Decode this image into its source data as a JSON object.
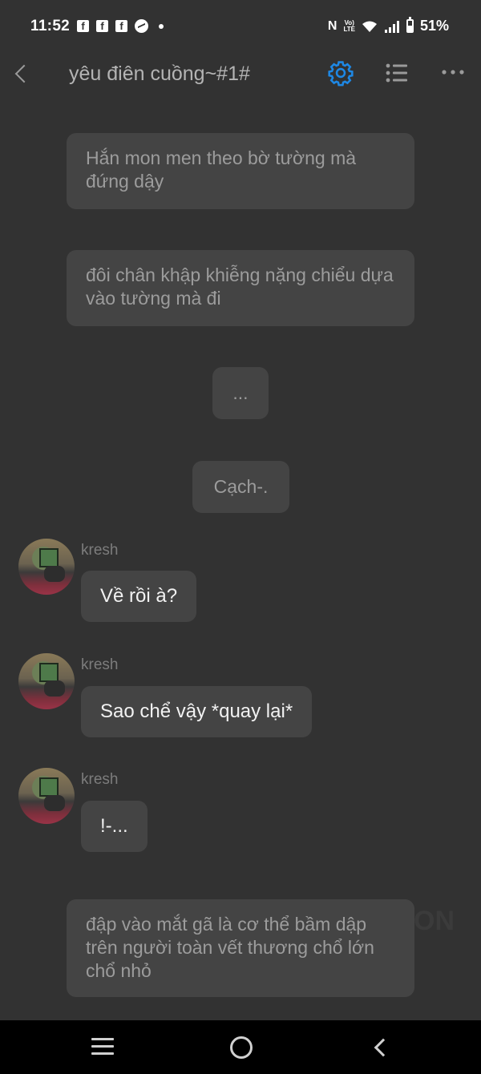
{
  "status_bar": {
    "time": "11:52",
    "battery": "51%",
    "battery_level": 0.51,
    "icons": [
      "facebook-icon",
      "facebook-icon",
      "facebook-icon",
      "messenger-icon",
      "dot-icon",
      "nfc-icon",
      "volte-icon",
      "wifi-icon",
      "signal-icon",
      "battery-icon"
    ]
  },
  "header": {
    "title": "yêu điên cuồng~#1#",
    "accent_color": "#1e88e5"
  },
  "messages": [
    {
      "type": "narration",
      "text": "Hắn mon men theo bờ tường mà đứng dậy"
    },
    {
      "type": "narration",
      "text": "đôi chân khập khiễng nặng chiểu dựa vào tường mà đi"
    },
    {
      "type": "narration",
      "text": "..."
    },
    {
      "type": "narration",
      "text": "Cạch-."
    },
    {
      "type": "character",
      "sender": "kresh",
      "text": "Về rồi à?"
    },
    {
      "type": "character",
      "sender": "kresh",
      "text": "Sao chể vậy *quay lại*"
    },
    {
      "type": "character",
      "sender": "kresh",
      "text": "!-..."
    },
    {
      "type": "narration",
      "text": "đập vào mắt gã là cơ thể bầm dập trên người toàn vết thương chổ lớn chổ nhỏ"
    }
  ],
  "watermark": "ON",
  "nav": [
    "recents-icon",
    "home-icon",
    "back-icon"
  ]
}
